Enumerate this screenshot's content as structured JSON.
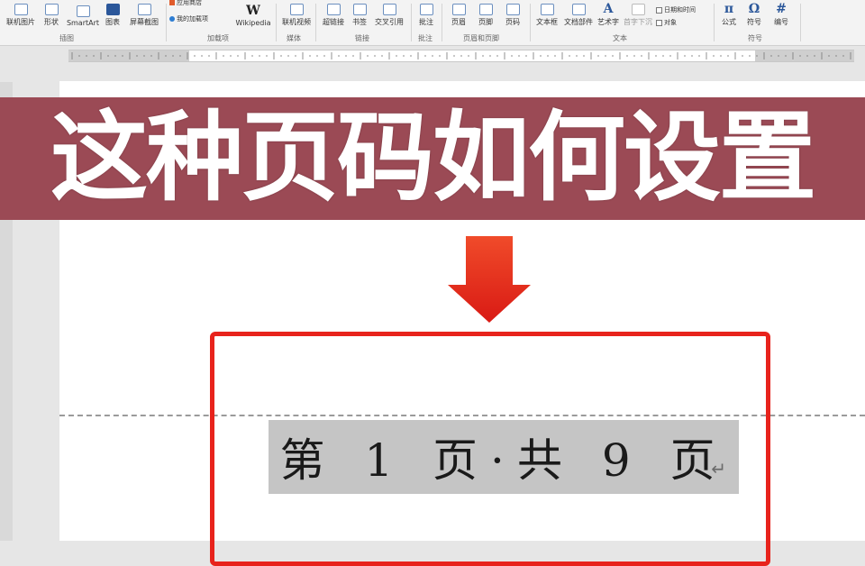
{
  "ribbon": {
    "buttons": [
      {
        "id": "online-picture",
        "label": "联机图片",
        "icon": "picture-icon"
      },
      {
        "id": "shapes",
        "label": "形状",
        "icon": "shapes-icon"
      },
      {
        "id": "smartart",
        "label": "SmartArt",
        "icon": "smartart-icon"
      },
      {
        "id": "chart",
        "label": "图表",
        "icon": "chart-icon"
      },
      {
        "id": "screenshot",
        "label": "屏幕截图",
        "icon": "camera-icon"
      },
      {
        "id": "wikipedia",
        "label": "Wikipedia",
        "icon": "wikipedia-icon",
        "glyph": "W"
      },
      {
        "id": "online-video",
        "label": "联机视频",
        "icon": "video-icon"
      },
      {
        "id": "link",
        "label": "超链接",
        "icon": "link-icon"
      },
      {
        "id": "bookmark",
        "label": "书签",
        "icon": "bookmark-icon"
      },
      {
        "id": "crossref",
        "label": "交叉引用",
        "icon": "crossref-icon"
      },
      {
        "id": "comment",
        "label": "批注",
        "icon": "comment-icon"
      },
      {
        "id": "header",
        "label": "页眉",
        "icon": "header-icon"
      },
      {
        "id": "footer",
        "label": "页脚",
        "icon": "footer-icon"
      },
      {
        "id": "page-number",
        "label": "页码",
        "icon": "page-number-icon"
      },
      {
        "id": "textbox",
        "label": "文本框",
        "icon": "textbox-icon"
      },
      {
        "id": "doc-parts",
        "label": "文档部件",
        "icon": "doc-parts-icon"
      },
      {
        "id": "wordart",
        "label": "艺术字",
        "icon": "wordart-icon",
        "glyph": "A"
      },
      {
        "id": "dropcap",
        "label": "首字下沉",
        "icon": "dropcap-icon"
      },
      {
        "id": "equation",
        "label": "公式",
        "icon": "equation-icon",
        "glyph": "π"
      },
      {
        "id": "symbol",
        "label": "符号",
        "icon": "omega-icon",
        "glyph": "Ω"
      },
      {
        "id": "number",
        "label": "编号",
        "icon": "number-icon",
        "glyph": "#"
      }
    ],
    "small": {
      "store": "应用商店",
      "my_addins": "我的加载项",
      "datetime": "日期和时间",
      "object": "对象"
    },
    "groups": {
      "illustrations": "插图",
      "addins": "加载项",
      "media": "媒体",
      "links": "链接",
      "comments": "批注",
      "header_footer": "页眉和页脚",
      "text": "文本",
      "symbols": "符号"
    }
  },
  "banner": {
    "text": "这种页码如何设置",
    "bg_color": "#9b4a55"
  },
  "page_field": {
    "text": "第 1 页·共 9 页",
    "para_mark": "↵"
  },
  "colors": {
    "highlight": "#e8231c",
    "field_shade": "#c5c5c5"
  }
}
